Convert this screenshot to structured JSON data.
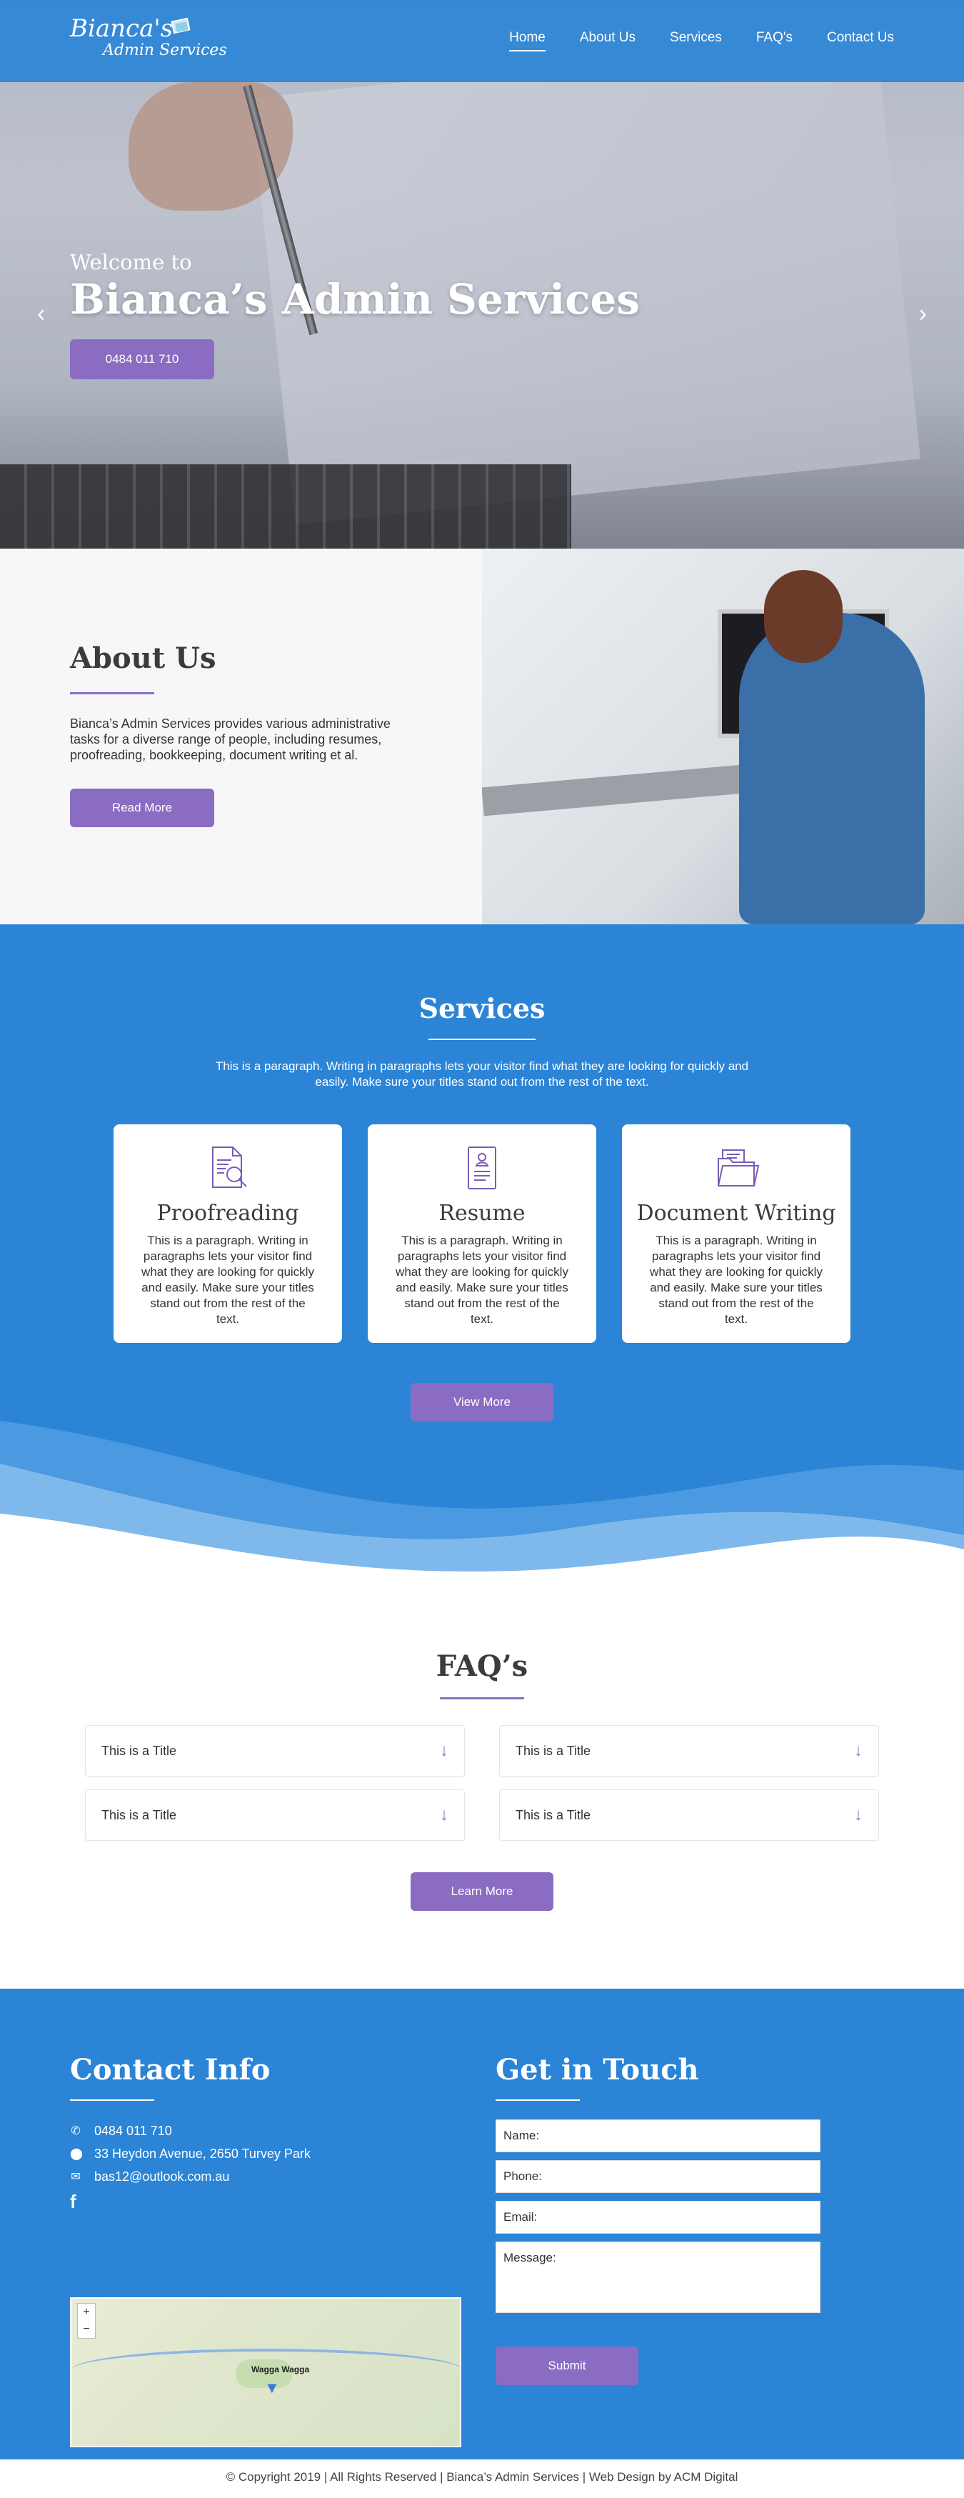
{
  "header": {
    "logo_line1": "Bianca's",
    "logo_line2": "Admin Services",
    "nav": [
      "Home",
      "About Us",
      "Services",
      "FAQ's",
      "Contact Us"
    ]
  },
  "hero": {
    "welcome": "Welcome to",
    "title": "Bianca’s Admin Services",
    "phone_button": "0484 011 710"
  },
  "about": {
    "title": "About Us",
    "text": "Bianca’s Admin Services provides various administrative tasks for a diverse range of people, including resumes, proofreading, bookkeeping, document writing et al.",
    "button": "Read More"
  },
  "services": {
    "title": "Services",
    "intro": "This is a paragraph. Writing in paragraphs lets your visitor find what they are looking for quickly and easily. Make sure your titles stand out from the rest of the text.",
    "cards": [
      {
        "icon": "proofreading-icon",
        "title": "Proofreading",
        "text": "This is a paragraph. Writing in paragraphs lets your visitor find what they are looking for quickly and easily. Make sure your titles stand out from the rest of the text."
      },
      {
        "icon": "resume-icon",
        "title": "Resume",
        "text": "This is a paragraph. Writing in paragraphs lets your visitor find what they are looking for quickly and easily. Make sure your titles stand out from the rest of the text."
      },
      {
        "icon": "document-writing-icon",
        "title": "Document Writing",
        "text": "This is a paragraph. Writing in paragraphs lets your visitor find what they are looking for quickly and easily. Make sure your titles stand out from the rest of the text."
      }
    ],
    "button": "View More"
  },
  "faq": {
    "title": "FAQ’s",
    "items": [
      "This is a Title",
      "This is a Title",
      "This is a Title",
      "This is a Title"
    ],
    "button": "Learn More"
  },
  "contact": {
    "info_title": "Contact Info",
    "phone": "0484 011 710",
    "address": "33 Heydon Avenue, 2650 Turvey Park",
    "email": "bas12@outlook.com.au",
    "map_label": "Wagga Wagga",
    "touch_title": "Get in Touch",
    "fields": {
      "name": "Name:",
      "phone": "Phone:",
      "email": "Email:",
      "message": "Message:"
    },
    "submit": "Submit"
  },
  "footer": {
    "text": "© Copyright 2019 | All Rights Reserved | Bianca’s Admin Services | Web Design by ACM Digital"
  },
  "colors": {
    "primary_blue": "#2b84d6",
    "accent_purple": "#8a6cc2"
  }
}
